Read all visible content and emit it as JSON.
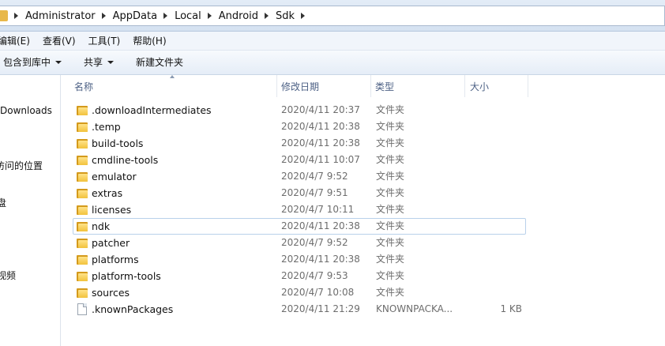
{
  "address_bar": {
    "breadcrumbs": [
      "Administrator",
      "AppData",
      "Local",
      "Android",
      "Sdk"
    ]
  },
  "menu": [
    "编辑(E)",
    "查看(V)",
    "工具(T)",
    "帮助(H)"
  ],
  "toolbar": {
    "include_library": "包含到库中",
    "share": "共享",
    "new_folder": "新建文件夹"
  },
  "nav": [
    "Downloads",
    "访问的位置",
    "盘",
    "视频"
  ],
  "columns": {
    "name": "名称",
    "date": "修改日期",
    "type": "类型",
    "size": "大小"
  },
  "files": [
    {
      "name": ".downloadIntermediates",
      "date": "2020/4/11 20:37",
      "type": "文件夹",
      "size": "",
      "icon": "folder-icon"
    },
    {
      "name": ".temp",
      "date": "2020/4/11 20:38",
      "type": "文件夹",
      "size": "",
      "icon": "folder-icon"
    },
    {
      "name": "build-tools",
      "date": "2020/4/11 20:38",
      "type": "文件夹",
      "size": "",
      "icon": "folder-icon"
    },
    {
      "name": "cmdline-tools",
      "date": "2020/4/11 10:07",
      "type": "文件夹",
      "size": "",
      "icon": "folder-icon"
    },
    {
      "name": "emulator",
      "date": "2020/4/7 9:52",
      "type": "文件夹",
      "size": "",
      "icon": "folder-icon"
    },
    {
      "name": "extras",
      "date": "2020/4/7 9:51",
      "type": "文件夹",
      "size": "",
      "icon": "folder-icon"
    },
    {
      "name": "licenses",
      "date": "2020/4/7 10:11",
      "type": "文件夹",
      "size": "",
      "icon": "folder-icon"
    },
    {
      "name": "ndk",
      "date": "2020/4/11 20:38",
      "type": "文件夹",
      "size": "",
      "icon": "folder-icon",
      "selected": true
    },
    {
      "name": "patcher",
      "date": "2020/4/7 9:52",
      "type": "文件夹",
      "size": "",
      "icon": "folder-icon"
    },
    {
      "name": "platforms",
      "date": "2020/4/11 20:38",
      "type": "文件夹",
      "size": "",
      "icon": "folder-icon"
    },
    {
      "name": "platform-tools",
      "date": "2020/4/7 9:53",
      "type": "文件夹",
      "size": "",
      "icon": "folder-icon"
    },
    {
      "name": "sources",
      "date": "2020/4/7 10:08",
      "type": "文件夹",
      "size": "",
      "icon": "folder-icon"
    },
    {
      "name": ".knownPackages",
      "date": "2020/4/11 21:29",
      "type": "KNOWNPACKA...",
      "size": "1 KB",
      "icon": "file-icon"
    }
  ]
}
